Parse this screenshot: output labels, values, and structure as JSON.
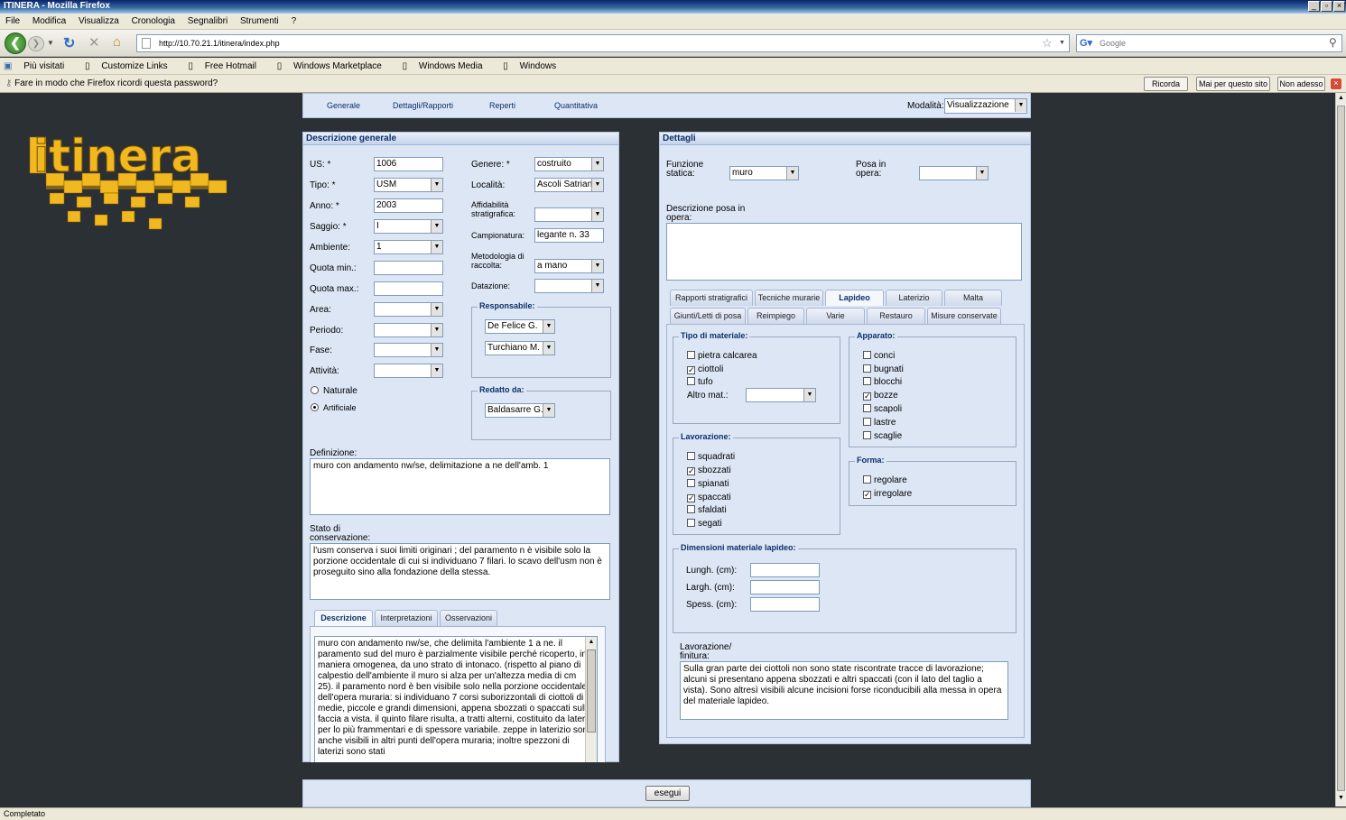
{
  "window": {
    "title": "ITINERA - Mozilla Firefox"
  },
  "menu": [
    "File",
    "Modifica",
    "Visualizza",
    "Cronologia",
    "Segnalibri",
    "Strumenti",
    "?"
  ],
  "nav": {
    "url": "http://10.70.21.1/itinera/index.php",
    "search_placeholder": "Google"
  },
  "bookmarks": [
    "Più visitati",
    "Customize Links",
    "Free Hotmail",
    "Windows Marketplace",
    "Windows Media",
    "Windows"
  ],
  "notification": {
    "text": "Fare in modo che Firefox ricordi questa password?",
    "buttons": [
      "Ricorda",
      "Mai per questo sito",
      "Non adesso"
    ]
  },
  "status": "Completato",
  "logo": "itinera",
  "topnav": {
    "links": [
      "Generale",
      "Dettagli/Rapporti",
      "Reperti",
      "Quantitativa"
    ],
    "mode_label": "Modalità:",
    "mode_value": "Visualizzazione"
  },
  "left": {
    "title": "Descrizione generale",
    "us_label": "US: *",
    "us": "1006",
    "tipo_label": "Tipo: *",
    "tipo": "USM",
    "anno_label": "Anno: *",
    "anno": "2003",
    "saggio_label": "Saggio: *",
    "saggio": "I",
    "ambiente_label": "Ambiente:",
    "ambiente": "1",
    "quota_min_label": "Quota min.:",
    "quota_max_label": "Quota max.:",
    "area_label": "Area:",
    "periodo_label": "Periodo:",
    "fase_label": "Fase:",
    "attivita_label": "Attività:",
    "naturale": "Naturale",
    "artificiale": "Artificiale",
    "genere_label": "Genere: *",
    "genere": "costruito",
    "localita_label": "Località:",
    "localita": "Ascoli Satrian",
    "affidabilita_label": "Affidabilità stratigrafica:",
    "campionatura_label": "Campionatura:",
    "campionatura": "legante n. 33",
    "metodologia_label": "Metodologia di raccolta:",
    "metodologia": "a mano",
    "datazione_label": "Datazione:",
    "responsabile_label": "Responsabile:",
    "responsabile1": "De Felice G.",
    "responsabile2": "Turchiano M.",
    "redatto_label": "Redatto da:",
    "redatto": "Baldasarre G.",
    "definizione_label": "Definizione:",
    "definizione": "muro con andamento nw/se, delimitazione a ne dell'amb. 1",
    "stato_label": "Stato di conservazione:",
    "stato": "l'usm conserva i suoi limiti originari ; del paramento n è visibile solo la porzione occidentale di cui si individuano 7 filari. lo scavo dell'usm non è proseguito sino alla fondazione della stessa.",
    "tabs": [
      "Descrizione",
      "Interpretazioni",
      "Osservazioni"
    ],
    "descrizione": "muro con andamento nw/se, che delimita l'ambiente 1 a ne. il paramento sud del muro è parzialmente visibile perché ricoperto, in maniera omogenea, da uno strato di intonaco. (rispetto al piano di calpestio dell'ambiente il muro si alza per un'altezza media di cm 25). il paramento nord è ben visibile solo nella porzione occidentale dell'opera muraria: si individuano 7 corsi suborizzontali di ciottoli di medie, piccole e grandi dimensioni, appena sbozzati o spaccati sulla faccia a vista. il quinto filare risulta, a tratti alterni, costituito da laterizi per lo più frammentari e di spessore variabile. zeppe in laterizio sono anche visibili in altri punti dell'opera muraria; inoltre spezzoni di laterizi sono stati"
  },
  "right": {
    "title": "Dettagli",
    "funzione_label": "Funzione statica:",
    "funzione": "muro",
    "posa_label": "Posa in opera:",
    "descr_posa_label": "Descrizione posa in opera:",
    "tabs_row1": [
      "Rapporti stratigrafici",
      "Tecniche murarie",
      "Lapideo",
      "Laterizio",
      "Malta"
    ],
    "tabs_row2": [
      "Giunti/Letti di posa",
      "Reimpiego",
      "Varie",
      "Restauro",
      "Misure conservate"
    ],
    "tipo_materiale": {
      "title": "Tipo di materiale:",
      "items": [
        {
          "label": "pietra calcarea",
          "checked": false
        },
        {
          "label": "ciottoli",
          "checked": true
        },
        {
          "label": "tufo",
          "checked": false
        }
      ],
      "altro_label": "Altro mat.:"
    },
    "apparato": {
      "title": "Apparato:",
      "items": [
        {
          "label": "conci",
          "checked": false
        },
        {
          "label": "bugnati",
          "checked": false
        },
        {
          "label": "blocchi",
          "checked": false
        },
        {
          "label": "bozze",
          "checked": true
        },
        {
          "label": "scapoli",
          "checked": false
        },
        {
          "label": "lastre",
          "checked": false
        },
        {
          "label": "scaglie",
          "checked": false
        }
      ]
    },
    "lavorazione": {
      "title": "Lavorazione:",
      "items": [
        {
          "label": "squadrati",
          "checked": false
        },
        {
          "label": "sbozzati",
          "checked": true
        },
        {
          "label": "spianati",
          "checked": false
        },
        {
          "label": "spaccati",
          "checked": true
        },
        {
          "label": "sfaldati",
          "checked": false
        },
        {
          "label": "segati",
          "checked": false
        }
      ]
    },
    "forma": {
      "title": "Forma:",
      "items": [
        {
          "label": "regolare",
          "checked": false
        },
        {
          "label": "irregolare",
          "checked": true
        }
      ]
    },
    "dimensioni": {
      "title": "Dimensioni materiale lapideo:",
      "lungh": "Lungh. (cm):",
      "largh": "Largh. (cm):",
      "spess": "Spess. (cm):"
    },
    "lavorazione_finitura_label": "Lavorazione/ finitura:",
    "lavorazione_finitura": "Sulla gran parte dei ciottoli non sono state riscontrate tracce di lavorazione; alcuni si presentano appena sbozzati e altri spaccati (con il lato del taglio a vista). Sono altresì visibili alcune incisioni forse riconducibili alla messa in opera del materiale lapideo."
  },
  "submit": "esegui",
  "colors": {
    "page_bg": "#2b3034",
    "panel": "#dce6f5",
    "header": "#0d2f6b",
    "logo": "#f1b820"
  }
}
